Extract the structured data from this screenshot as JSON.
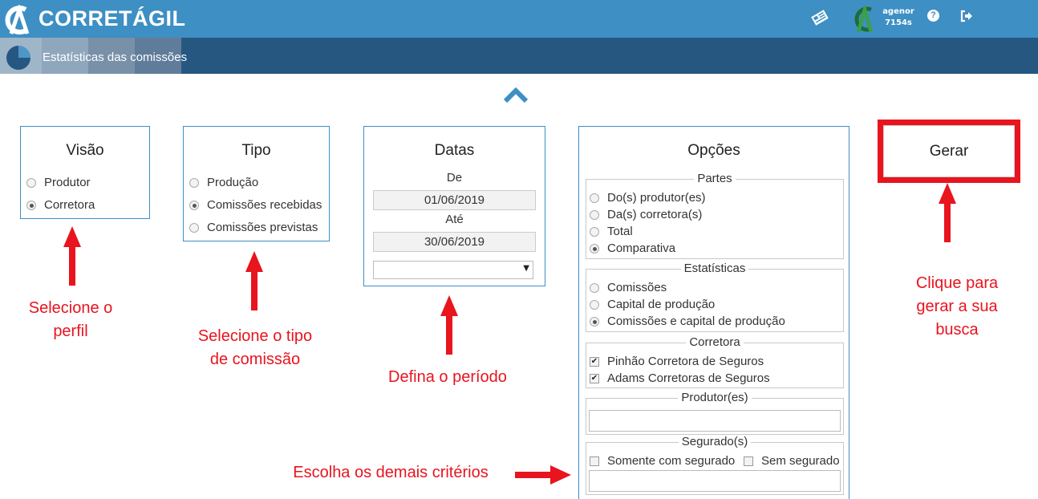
{
  "app": {
    "name": "CORRETÁGIL",
    "user_name": "agenor",
    "user_code": "7154s",
    "help_glyph": "?"
  },
  "subbar": {
    "title": "Estatísticas das comissões"
  },
  "colors": {
    "topbar": "#3d8fc4",
    "subbar": "#265781",
    "panel_border": "#3d8fc4",
    "annotation": "#e8141e"
  },
  "icons": [
    "logo-icon",
    "news-icon",
    "help-icon",
    "logout-icon",
    "pie-chart-icon",
    "chevron-up-icon"
  ],
  "visao": {
    "title": "Visão",
    "options": [
      {
        "label": "Produtor",
        "selected": false
      },
      {
        "label": "Corretora",
        "selected": true
      }
    ]
  },
  "tipo": {
    "title": "Tipo",
    "options": [
      {
        "label": "Produção",
        "selected": false
      },
      {
        "label": "Comissões recebidas",
        "selected": true
      },
      {
        "label": "Comissões previstas",
        "selected": false
      }
    ]
  },
  "datas": {
    "title": "Datas",
    "from_label": "De",
    "from_value": "01/06/2019",
    "to_label": "Até",
    "to_value": "30/06/2019",
    "period_select": ""
  },
  "opcoes": {
    "title": "Opções",
    "partes": {
      "legend": "Partes",
      "options": [
        {
          "label": "Do(s) produtor(es)",
          "selected": false
        },
        {
          "label": "Da(s) corretora(s)",
          "selected": false
        },
        {
          "label": "Total",
          "selected": false
        },
        {
          "label": "Comparativa",
          "selected": true
        }
      ]
    },
    "estatisticas": {
      "legend": "Estatísticas",
      "options": [
        {
          "label": "Comissões",
          "selected": false
        },
        {
          "label": "Capital de produção",
          "selected": false
        },
        {
          "label": "Comissões e capital de produção",
          "selected": true
        }
      ]
    },
    "corretora": {
      "legend": "Corretora",
      "options": [
        {
          "label": "Pinhão Corretora de Seguros",
          "checked": true
        },
        {
          "label": "Adams Corretoras de Seguros",
          "checked": true
        }
      ]
    },
    "produtores": {
      "legend": "Produtor(es)",
      "value": ""
    },
    "segurados": {
      "legend": "Segurado(s)",
      "only_with": "Somente com segurado",
      "only_with_checked": false,
      "without": "Sem segurado",
      "without_checked": false,
      "value": ""
    }
  },
  "gerar": {
    "label": "Gerar"
  },
  "annotations": {
    "perfil": [
      "Selecione o",
      "perfil"
    ],
    "tipo": [
      "Selecione o tipo",
      "de comissão"
    ],
    "periodo": "Defina o período",
    "criterios": "Escolha os demais critérios",
    "gerar": [
      "Clique para",
      "gerar a sua",
      "busca"
    ]
  }
}
